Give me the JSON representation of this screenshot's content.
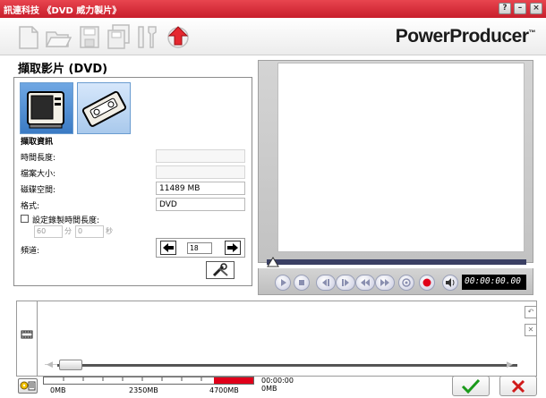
{
  "window": {
    "title": "訊連科技 《DVD 威力製片》",
    "help_glyph": "?",
    "minimize_glyph": "–",
    "close_glyph": "×"
  },
  "toolbar": {
    "icons": [
      "new-page-icon",
      "open-folder-icon",
      "save-icon",
      "save-as-icon",
      "settings-icon",
      "upgrade-icon"
    ],
    "brand": "PowerProducer",
    "brand_tm": "™"
  },
  "capture": {
    "section_title": "擷取影片 (DVD)",
    "sources": [
      {
        "name": "tv-capture-icon",
        "selected": true
      },
      {
        "name": "vcr-capture-icon",
        "selected": false
      }
    ],
    "info_heading": "擷取資訊",
    "fields": [
      {
        "label": "時間長度:",
        "value": ""
      },
      {
        "label": "檔案大小:",
        "value": ""
      },
      {
        "label": "磁碟空間:",
        "value": "11489 MB"
      },
      {
        "label": "格式:",
        "value": "DVD"
      }
    ],
    "set_duration_label": "設定錄製時間長度:",
    "duration_min": "60",
    "duration_min_unit": "分",
    "duration_sec": "0",
    "duration_sec_unit": "秒",
    "channel_label": "頻道:",
    "channel_value": "18",
    "prev_glyph": "🡄",
    "next_glyph": "🡆"
  },
  "preview": {
    "timecode": "00:00:00.00",
    "controls": [
      "play-icon",
      "stop-icon",
      "prev-frame-icon",
      "next-frame-icon",
      "rewind-icon",
      "fast-forward-icon",
      "snapshot-icon",
      "record-icon",
      "mute-icon"
    ]
  },
  "timeline": {
    "undo_glyph": "↶",
    "delete_glyph": "✕"
  },
  "bottom": {
    "capacity_labels": [
      "0MB",
      "2350MB",
      "4700MB"
    ],
    "used_time": "00:00:00",
    "used_size": "0MB",
    "colors": {
      "capacity_used": "#e0001a",
      "accent": "#d22230",
      "ok": "#1a9a1a",
      "cancel": "#d01a1a"
    }
  }
}
